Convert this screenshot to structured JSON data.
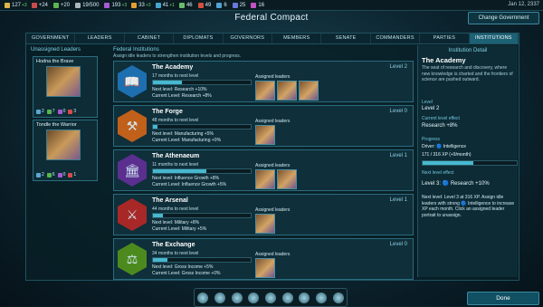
{
  "topbar": {
    "resources": [
      {
        "icon": "energy-icon",
        "value": "127",
        "delta": "+3",
        "color": "#e0b64a"
      },
      {
        "icon": "minerals-icon",
        "value": "+24",
        "delta": "",
        "color": "#c84b4b"
      },
      {
        "icon": "food-icon",
        "value": "+20",
        "delta": "",
        "color": "#5bb552"
      },
      {
        "icon": "alloys-icon",
        "value": "19/500",
        "delta": "",
        "color": "#aab7bd"
      },
      {
        "icon": "influence-icon",
        "value": "193",
        "delta": "+3",
        "color": "#a55bd3"
      },
      {
        "icon": "unity-icon",
        "value": "33",
        "delta": "+3",
        "color": "#e3a02e"
      },
      {
        "icon": "research-icon",
        "value": "41",
        "delta": "+1",
        "color": "#44a6cf"
      },
      {
        "icon": "trade-icon",
        "value": "46",
        "delta": "",
        "color": "#6bbb6b"
      },
      {
        "icon": "consumer-goods-icon",
        "value": "49",
        "delta": "",
        "color": "#d3503f"
      },
      {
        "icon": "gems-icon",
        "value": "6",
        "delta": "",
        "color": "#4fa3d6"
      },
      {
        "icon": "crystals-icon",
        "value": "25",
        "delta": "",
        "color": "#6a78d6"
      },
      {
        "icon": "gas-icon",
        "value": "16",
        "delta": "",
        "color": "#c252c2"
      }
    ],
    "date": "Jan 12, 2337"
  },
  "header": {
    "title": "Federal Compact",
    "change_government": "Change Government"
  },
  "tabs": [
    "GOVERNMENT",
    "LEADERS",
    "CABINET",
    "DIPLOMATS",
    "GOVERNORS",
    "MEMBERS",
    "SENATE",
    "COMMANDERS",
    "PARTIES",
    "INSTITUTIONS"
  ],
  "leaders": {
    "title": "Unassigned Leaders",
    "items": [
      {
        "name": "Hodna the Brave",
        "stats": [
          "2",
          "7",
          "0",
          "3"
        ]
      },
      {
        "name": "Tondle the Warrior",
        "stats": [
          "2",
          "6",
          "0",
          "1"
        ]
      }
    ]
  },
  "institutions": {
    "title": "Federal Institutions",
    "subtitle": "Assign idle leaders to strengthen institution levels and progress.",
    "assigned_label": "Assigned leaders",
    "next_level_label": "Next level:",
    "current_level_label": "Current Level:",
    "items": [
      {
        "name": "The Academy",
        "level": "Level 2",
        "months": "17 months to next level",
        "progress": 0.3,
        "next": "Research +10%",
        "current": "Research +8%",
        "hex_color": "#1e6fb0",
        "glyph": "📖",
        "leaders": 3
      },
      {
        "name": "The Forge",
        "level": "Level 0",
        "months": "48 months to next level",
        "progress": 0.05,
        "next": "Manufacturing +5%",
        "current": "Manufacturing +0%",
        "hex_color": "#c0601a",
        "glyph": "⚒",
        "leaders": 1
      },
      {
        "name": "The Athenaeum",
        "level": "Level 1",
        "months": "11 months to next level",
        "progress": 0.55,
        "next": "Influence Growth +8%",
        "current": "Influence Growth +5%",
        "hex_color": "#5a2f8f",
        "glyph": "🏛",
        "leaders": 2
      },
      {
        "name": "The Arsenal",
        "level": "Level 1",
        "months": "44 months to next level",
        "progress": 0.1,
        "next": "Military +8%",
        "current": "Military +5%",
        "hex_color": "#a82828",
        "glyph": "⚔",
        "leaders": 1
      },
      {
        "name": "The Exchange",
        "level": "Level 0",
        "months": "34 months to next level",
        "progress": 0.15,
        "next": "Gross Income +5%",
        "current": "Gross Income +0%",
        "hex_color": "#4d8a1e",
        "glyph": "⚖",
        "leaders": 1
      }
    ]
  },
  "detail": {
    "title": "Institution Detail",
    "name": "The Academy",
    "description": "The seat of research and discovery, where new knowledge is charted and the frontiers of science are pushed outward.",
    "level_label": "Level",
    "level_value": "Level 2",
    "current_effect_label": "Current level effect",
    "current_effect": "Research +8%",
    "progress_label": "Progress",
    "driver": "Driver: 🔵 Intelligence",
    "xp": "171 / 316 XP (+9/month)",
    "progress": 0.54,
    "next_effect_label": "Next level effect",
    "next_effect": "Level 3: 🔵 Research +10%",
    "help": "Next level: Level 3 at 316 XP. Assign idle leaders with strong 🔵 Intelligence to increase XP each month. Click an assigned leader portrait to unassign."
  },
  "footer": {
    "done": "Done"
  }
}
